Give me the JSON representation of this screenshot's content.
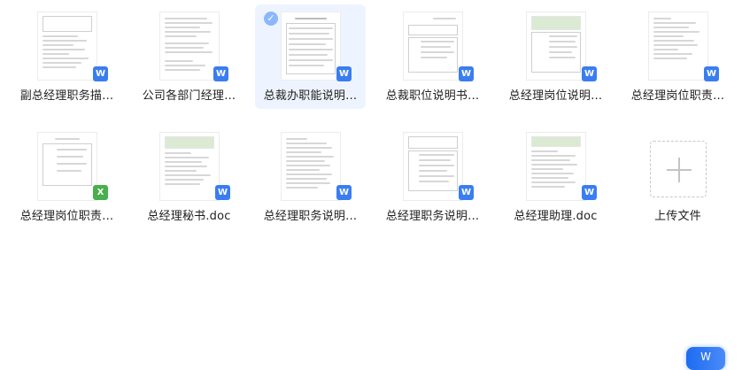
{
  "files": [
    {
      "name": "副总经理职务描…",
      "type": "word",
      "selected": false
    },
    {
      "name": "公司各部门经理…",
      "type": "word",
      "selected": false
    },
    {
      "name": "总裁办职能说明…",
      "type": "word",
      "selected": true
    },
    {
      "name": "总裁职位说明书…",
      "type": "word",
      "selected": false
    },
    {
      "name": "总经理岗位说明…",
      "type": "word",
      "selected": false
    },
    {
      "name": "总经理岗位职责…",
      "type": "word",
      "selected": false
    },
    {
      "name": "总经理岗位职责…",
      "type": "excel",
      "selected": false
    },
    {
      "name": "总经理秘书.doc",
      "type": "word",
      "selected": false
    },
    {
      "name": "总经理职务说明…",
      "type": "word",
      "selected": false
    },
    {
      "name": "总经理职务说明…",
      "type": "word",
      "selected": false
    },
    {
      "name": "总经理助理.doc",
      "type": "word",
      "selected": false
    }
  ],
  "upload": {
    "label": "上传文件",
    "icon": "plus-icon"
  },
  "badges": {
    "word": "W",
    "excel": "X"
  },
  "selected_check": "✓",
  "fab": {
    "icon": "word-app-icon",
    "glyph": "W"
  },
  "colors": {
    "word": "#3a7df0",
    "excel": "#48b04c",
    "selected_bg": "#eef4ff"
  }
}
